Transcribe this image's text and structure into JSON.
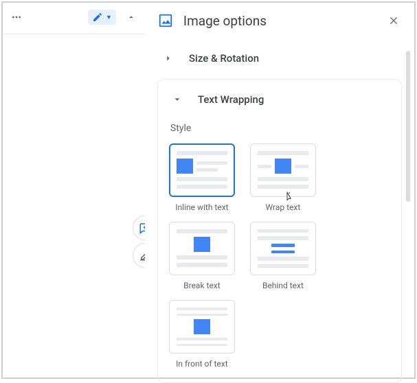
{
  "toolbar": {
    "more_label": "More",
    "edit_mode": "Editing",
    "collapse": "Collapse"
  },
  "panel": {
    "title": "Image options",
    "close": "Close"
  },
  "sections": {
    "size_rotation": {
      "title": "Size & Rotation",
      "expanded": false
    },
    "text_wrapping": {
      "title": "Text Wrapping",
      "expanded": true,
      "style_label": "Style",
      "options": [
        {
          "id": "inline",
          "label": "Inline with text",
          "selected": true
        },
        {
          "id": "wrap",
          "label": "Wrap text",
          "selected": false
        },
        {
          "id": "break",
          "label": "Break text",
          "selected": false
        },
        {
          "id": "behind",
          "label": "Behind text",
          "selected": false
        },
        {
          "id": "front",
          "label": "In front of text",
          "selected": false
        }
      ]
    }
  }
}
